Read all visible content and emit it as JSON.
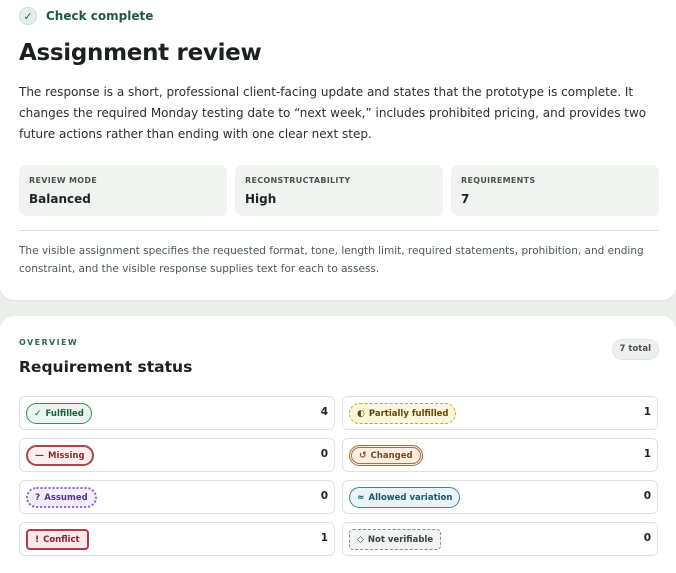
{
  "status": {
    "icon": "checkmark-icon",
    "icon_glyph": "✓",
    "label": "Check complete"
  },
  "title": "Assignment review",
  "summary": "The response is a short, professional client-facing update and states that the prototype is complete. It changes the required Monday testing date to “next week,” includes prohibited pricing, and provides two future actions rather than ending with one clear next step.",
  "meta": {
    "mode": {
      "label": "REVIEW MODE",
      "value": "Balanced"
    },
    "reconstructability": {
      "label": "RECONSTRUCTABILITY",
      "value": "High"
    },
    "requirements": {
      "label": "REQUIREMENTS",
      "value": "7"
    }
  },
  "note": "The visible assignment specifies the requested format, tone, length limit, required statements, prohibition, and ending constraint, and the visible response supplies text for each to assess.",
  "overview": {
    "eyebrow": "OVERVIEW",
    "title": "Requirement status",
    "total": "7 total",
    "items": [
      {
        "label": "Fulfilled",
        "glyph": "✓",
        "icon": "check-icon",
        "count": "4"
      },
      {
        "label": "Partially fulfilled",
        "glyph": "◐",
        "icon": "half-circle-icon",
        "count": "1"
      },
      {
        "label": "Missing",
        "glyph": "—",
        "icon": "dash-icon",
        "count": "0"
      },
      {
        "label": "Changed",
        "glyph": "↺",
        "icon": "rotate-icon",
        "count": "1"
      },
      {
        "label": "Assumed",
        "glyph": "?",
        "icon": "question-icon",
        "count": "0"
      },
      {
        "label": "Allowed variation",
        "glyph": "≈",
        "icon": "approx-icon",
        "count": "0"
      },
      {
        "label": "Conflict",
        "glyph": "!",
        "icon": "exclamation-icon",
        "count": "1"
      },
      {
        "label": "Not verifiable",
        "glyph": "◇",
        "icon": "diamond-icon",
        "count": "0"
      }
    ]
  }
}
